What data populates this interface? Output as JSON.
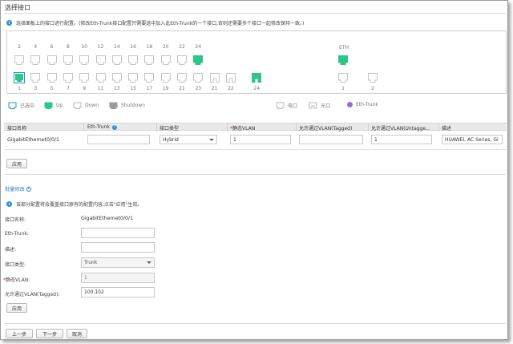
{
  "title": "选择接口",
  "tip": "选择面板上的接口进行配置。(修改Eth-Trunk接口配置只需要选中加入此Eth-Trunk的一个接口,否则还需要多个接口一起修改保持一致。)",
  "panel": {
    "eth_label": "ETH",
    "top_numbers": [
      "2",
      "4",
      "6",
      "8",
      "10",
      "12",
      "14",
      "16",
      "18",
      "20",
      "22",
      "24"
    ],
    "bottom_numbers": [
      "1",
      "3",
      "5",
      "7",
      "9",
      "11",
      "13",
      "15",
      "17",
      "19",
      "21",
      "23",
      "21",
      "22",
      "24"
    ],
    "eth_numbers": [
      "1",
      "2"
    ]
  },
  "legend": {
    "selected": "已选中",
    "up": "Up",
    "down": "Down",
    "shutdown": "Shutdown",
    "electric": "电口",
    "optical": "光口",
    "eth_trunk": "Eth-Trunk"
  },
  "table": {
    "headers": [
      "接口名称",
      "Eth-Trunk",
      "接口类型",
      "静态VLAN",
      "允许通过VLAN(Tagged)",
      "允许通过VLAN(Untagge...",
      "描述"
    ],
    "row": {
      "name": "GigabitEthernet0/0/1",
      "eth_trunk": "",
      "type": "Hybrid",
      "pvid": "1",
      "tagged": "",
      "untagged": "1",
      "desc": "HUAWEI, AC Series, Gi"
    }
  },
  "apply_label": "应用",
  "batch": {
    "title": "批量修改",
    "tip": "该部分配置将会覆盖接口原有的配置内容,点击\"应用\"生效。",
    "labels": {
      "name": "接口名称:",
      "eth_trunk": "Eth-Trunk:",
      "desc": "描述:",
      "type": "接口类型:",
      "pvid": "静态VLAN:",
      "tagged": "允许通过VLAN(Tagged):"
    },
    "values": {
      "name": "GigabitEthernet0/0/1",
      "eth_trunk": "",
      "desc": "",
      "type": "Trunk",
      "pvid": "1",
      "tagged": "100,102"
    }
  },
  "footer": {
    "prev": "上一步",
    "next": "下一步",
    "cancel": "取消"
  },
  "colors": {
    "up": "#2cc58a",
    "down": "#ffffff",
    "selected_border": "#2a8fd8",
    "shutdown": "#9a9a9a",
    "eth_trunk": "#a06ad4"
  }
}
